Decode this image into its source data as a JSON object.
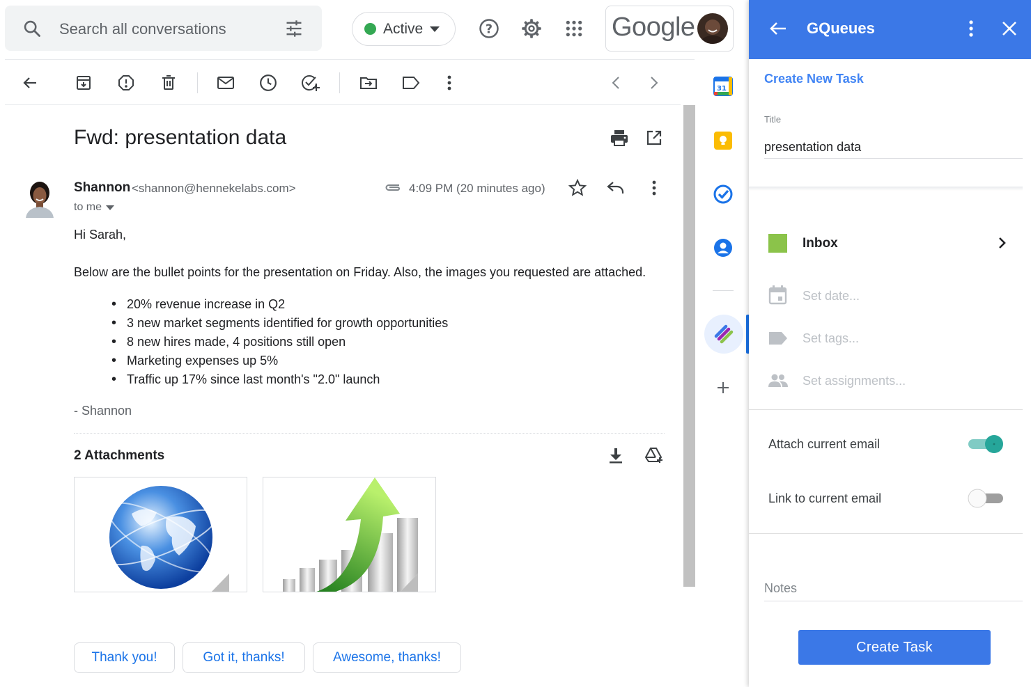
{
  "search": {
    "placeholder": "Search all conversations"
  },
  "status": {
    "label": "Active"
  },
  "brand": {
    "word": "Google"
  },
  "email": {
    "subject": "Fwd: presentation data",
    "sender_name": "Shannon",
    "sender_email": "<shannon@hennekelabs.com>",
    "to": "to me",
    "time": "4:09 PM (20 minutes ago)",
    "greeting": "Hi Sarah,",
    "intro": "Below are the bullet points for the presentation on Friday. Also, the images you requested are attached.",
    "bullets": [
      "20% revenue increase in Q2",
      "3 new market segments identified for growth opportunities",
      "8 new hires made, 4 positions still open",
      "Marketing expenses up 5%",
      "Traffic up 17% since last month's \"2.0\" launch"
    ],
    "signoff": "- Shannon",
    "attachments_title": "2 Attachments"
  },
  "smart_replies": [
    "Thank you!",
    "Got it, thanks!",
    "Awesome, thanks!"
  ],
  "rail": {
    "calendar_day": "31"
  },
  "panel": {
    "title": "GQueues",
    "section": "Create New Task",
    "title_label": "Title",
    "title_value": "presentation data",
    "queue": "Inbox",
    "set_date": "Set date...",
    "set_tags": "Set tags...",
    "set_assignments": "Set assignments...",
    "attach_email": "Attach current email",
    "link_email": "Link to current email",
    "attach_on": true,
    "link_on": false,
    "notes": "Notes",
    "create_button": "Create Task"
  },
  "colors": {
    "accent": "#3b78e7",
    "link": "#1a73e8",
    "active_dot": "#34a853",
    "inbox_square": "#8bc34a",
    "toggle_on": "#26a69a"
  }
}
